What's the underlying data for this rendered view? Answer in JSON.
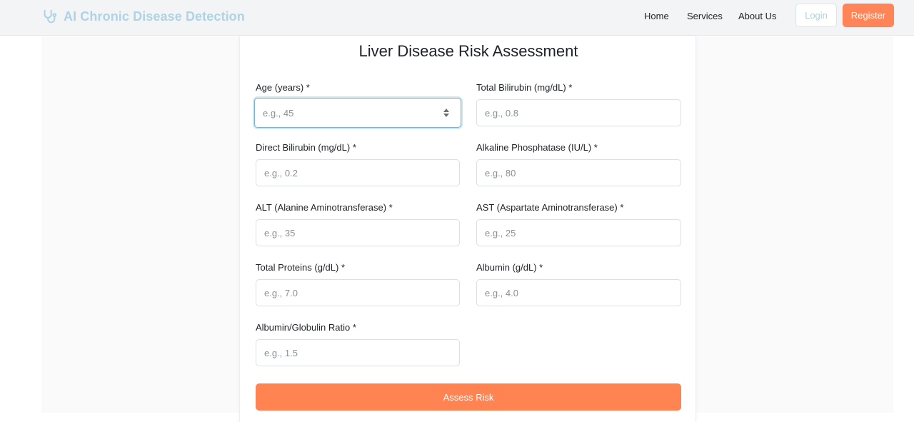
{
  "header": {
    "brand_title": "AI Chronic Disease Detection",
    "brand_icon": "stethoscope-icon",
    "nav": {
      "home": "Home",
      "services": "Services",
      "about": "About Us"
    },
    "login_label": "Login",
    "register_label": "Register"
  },
  "colors": {
    "accent_orange": "#ff8452",
    "brand_light_blue": "#aed3e4",
    "focus_ring": "#cfe6ef"
  },
  "form": {
    "title": "Liver Disease Risk Assessment",
    "fields": [
      {
        "label": "Age (years) *",
        "placeholder": "e.g., 45",
        "value": ""
      },
      {
        "label": "Total Bilirubin (mg/dL) *",
        "placeholder": "e.g., 0.8",
        "value": ""
      },
      {
        "label": "Direct Bilirubin (mg/dL) *",
        "placeholder": "e.g., 0.2",
        "value": ""
      },
      {
        "label": "Alkaline Phosphatase (IU/L) *",
        "placeholder": "e.g., 80",
        "value": ""
      },
      {
        "label": "ALT (Alanine Aminotransferase) *",
        "placeholder": "e.g., 35",
        "value": ""
      },
      {
        "label": "AST (Aspartate Aminotransferase) *",
        "placeholder": "e.g., 25",
        "value": ""
      },
      {
        "label": "Total Proteins (g/dL) *",
        "placeholder": "e.g., 7.0",
        "value": ""
      },
      {
        "label": "Albumin (g/dL) *",
        "placeholder": "e.g., 4.0",
        "value": ""
      },
      {
        "label": "Albumin/Globulin Ratio *",
        "placeholder": "e.g., 1.5",
        "value": ""
      }
    ],
    "submit_label": "Assess Risk"
  }
}
